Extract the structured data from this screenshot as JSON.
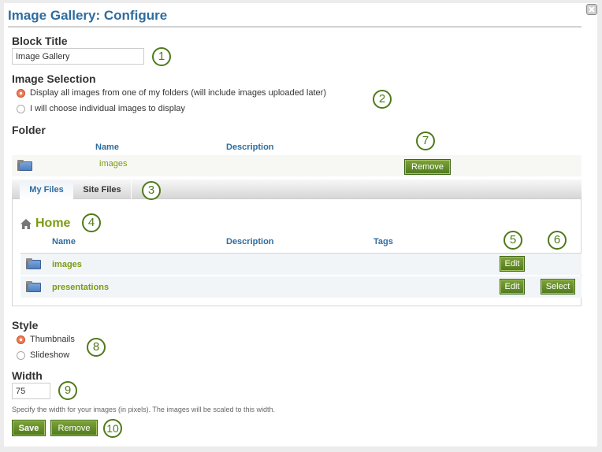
{
  "dialog": {
    "title": "Image Gallery: Configure",
    "close_icon": "close-icon"
  },
  "block_title": {
    "label": "Block Title",
    "value": "Image Gallery",
    "callout": "1"
  },
  "image_selection": {
    "label": "Image Selection",
    "options": [
      {
        "label": "Display all images from one of my folders (will include images uploaded later)",
        "selected": true
      },
      {
        "label": "I will choose individual images to display",
        "selected": false
      }
    ],
    "callout": "2"
  },
  "folder": {
    "label": "Folder",
    "columns": [
      "Name",
      "Description"
    ],
    "selected": {
      "icon": "folder-icon",
      "name": "images",
      "description": "",
      "remove_label": "Remove"
    },
    "callout": "7"
  },
  "tabs": {
    "items": [
      {
        "label": "My Files",
        "active": true
      },
      {
        "label": "Site Files",
        "active": false
      }
    ],
    "callout": "3"
  },
  "browser": {
    "home_label": "Home",
    "home_icon": "home-icon",
    "callout_home": "4",
    "columns": [
      "Name",
      "Description",
      "Tags"
    ],
    "callout_edit": "5",
    "callout_select": "6",
    "rows": [
      {
        "icon": "folder-icon",
        "name": "images",
        "description": "",
        "tags": "",
        "edit_label": "Edit",
        "select_label": ""
      },
      {
        "icon": "folder-icon",
        "name": "presentations",
        "description": "",
        "tags": "",
        "edit_label": "Edit",
        "select_label": "Select"
      }
    ]
  },
  "style": {
    "label": "Style",
    "options": [
      {
        "label": "Thumbnails",
        "selected": true
      },
      {
        "label": "Slideshow",
        "selected": false
      }
    ],
    "callout": "8"
  },
  "width": {
    "label": "Width",
    "value": "75",
    "help": "Specify the width for your images (in pixels). The images will be scaled to this width.",
    "callout": "9"
  },
  "actions": {
    "save_label": "Save",
    "remove_label": "Remove",
    "callout": "10"
  },
  "colors": {
    "title": "#2f6c9f",
    "link": "#7b9a12",
    "button": "#5f8a25",
    "callout": "#4e7a1a",
    "radio_selected": "#ee7b55"
  }
}
